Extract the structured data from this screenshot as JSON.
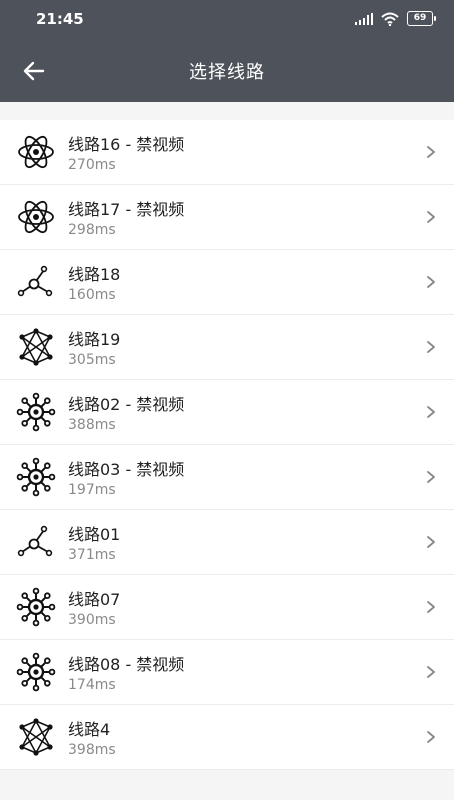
{
  "status": {
    "time": "21:45",
    "battery": "69",
    "icons": [
      "signal-icon",
      "wifi-icon",
      "battery-icon"
    ]
  },
  "appbar": {
    "title": "选择线路",
    "back_icon": "arrow-left-icon"
  },
  "routes": [
    {
      "name": "线路16 - 禁视频",
      "latency": "270ms",
      "icon": "atom-icon"
    },
    {
      "name": "线路17 - 禁视频",
      "latency": "298ms",
      "icon": "atom-icon"
    },
    {
      "name": "线路18",
      "latency": "160ms",
      "icon": "network-node-icon"
    },
    {
      "name": "线路19",
      "latency": "305ms",
      "icon": "mesh-network-icon"
    },
    {
      "name": "线路02 - 禁视频",
      "latency": "388ms",
      "icon": "hub-icon"
    },
    {
      "name": "线路03 - 禁视频",
      "latency": "197ms",
      "icon": "hub-icon"
    },
    {
      "name": "线路01",
      "latency": "371ms",
      "icon": "network-node-icon"
    },
    {
      "name": "线路07",
      "latency": "390ms",
      "icon": "hub-icon"
    },
    {
      "name": "线路08 - 禁视频",
      "latency": "174ms",
      "icon": "hub-icon"
    },
    {
      "name": "线路4",
      "latency": "398ms",
      "icon": "mesh-network-icon"
    }
  ]
}
